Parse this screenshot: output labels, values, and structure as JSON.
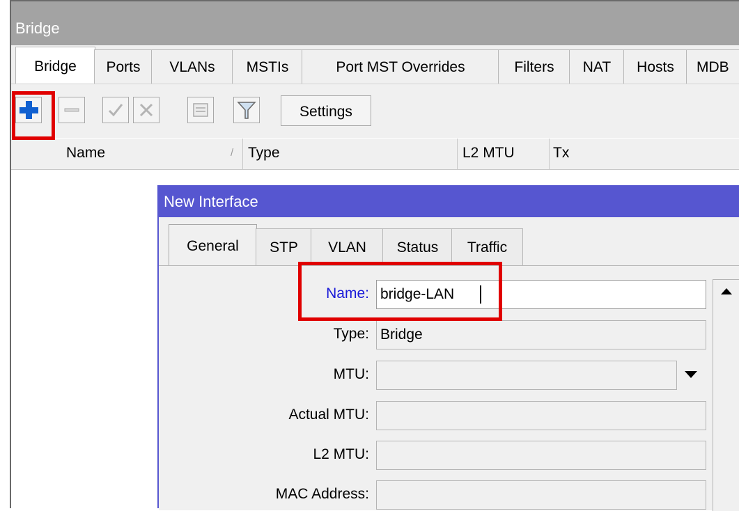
{
  "window": {
    "title": "Bridge",
    "tabs": [
      "Bridge",
      "Ports",
      "VLANs",
      "MSTIs",
      "Port MST Overrides",
      "Filters",
      "NAT",
      "Hosts",
      "MDB"
    ],
    "active_tab": "Bridge"
  },
  "toolbar": {
    "settings_label": "Settings",
    "icons": [
      "add-icon",
      "remove-icon",
      "enable-icon",
      "disable-icon",
      "comment-icon",
      "filter-icon"
    ]
  },
  "table": {
    "columns": [
      "Name",
      "Type",
      "L2 MTU",
      "Tx"
    ],
    "sort_indicator": "/",
    "rows": []
  },
  "dialog": {
    "title": "New Interface",
    "tabs": [
      "General",
      "STP",
      "VLAN",
      "Status",
      "Traffic"
    ],
    "active_tab": "General",
    "fields": {
      "name": {
        "label": "Name:",
        "value": "bridge-LAN"
      },
      "type": {
        "label": "Type:",
        "value": "Bridge"
      },
      "mtu": {
        "label": "MTU:",
        "value": ""
      },
      "actual_mtu": {
        "label": "Actual MTU:",
        "value": ""
      },
      "l2_mtu": {
        "label": "L2 MTU:",
        "value": ""
      },
      "mac_address": {
        "label": "MAC Address:",
        "value": ""
      }
    }
  },
  "colors": {
    "title_bar": "#a3a3a3",
    "dialog_title_bar": "#5656d0",
    "highlight": "#e00000",
    "add_icon": "#1060d0",
    "name_label": "#1a1ad8"
  }
}
